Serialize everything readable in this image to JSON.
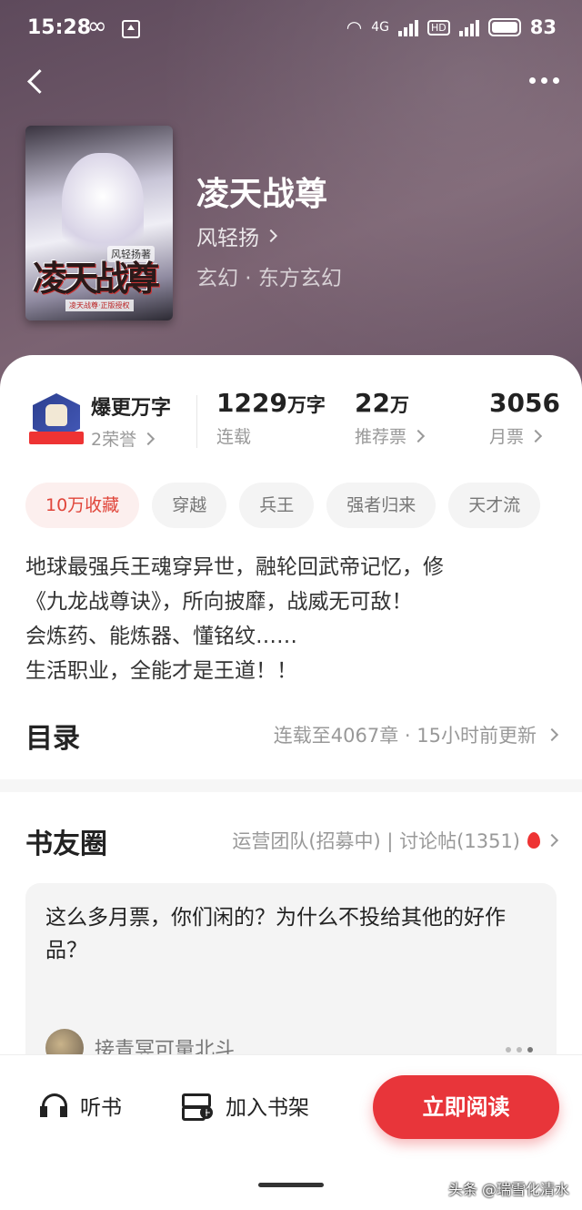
{
  "status_bar": {
    "time": "15:28",
    "battery": "83",
    "net": "4G",
    "hd": "HD"
  },
  "book": {
    "title": "凌天战尊",
    "author": "风轻扬",
    "genre": "玄幻 · 东方玄幻",
    "cover": {
      "title": "凌天战尊",
      "author": "风轻扬著",
      "tag": "凌天战尊·正版授权"
    }
  },
  "stats": {
    "honor_title": "爆更万字",
    "honor_sub": "2荣誉",
    "words_num": "1229",
    "words_unit": "万字",
    "words_label": "连载",
    "rec_num": "22",
    "rec_unit": "万",
    "rec_label": "推荐票",
    "month_num": "3056",
    "month_label": "月票"
  },
  "tags": [
    "10万收藏",
    "穿越",
    "兵王",
    "强者归来",
    "天才流"
  ],
  "intro": [
    "地球最强兵王魂穿异世，融轮回武帝记忆，修",
    "《九龙战尊诀》，所向披靡，战威无可敌！",
    "会炼药、能炼器、懂铭纹……",
    "生活职业，全能才是王道！！"
  ],
  "toc": {
    "title": "目录",
    "info": "连载至4067章 · 15小时前更新"
  },
  "circle": {
    "title": "书友圈",
    "info": "运营团队(招募中) | 讨论帖(1351)",
    "post_text": "这么多月票，你们闲的？为什么不投给其他的好作品？",
    "post_user": "接青冥可量北斗"
  },
  "bottom": {
    "listen": "听书",
    "shelf": "加入书架",
    "read": "立即阅读"
  },
  "watermark": "头条 @瑞雪化清水"
}
